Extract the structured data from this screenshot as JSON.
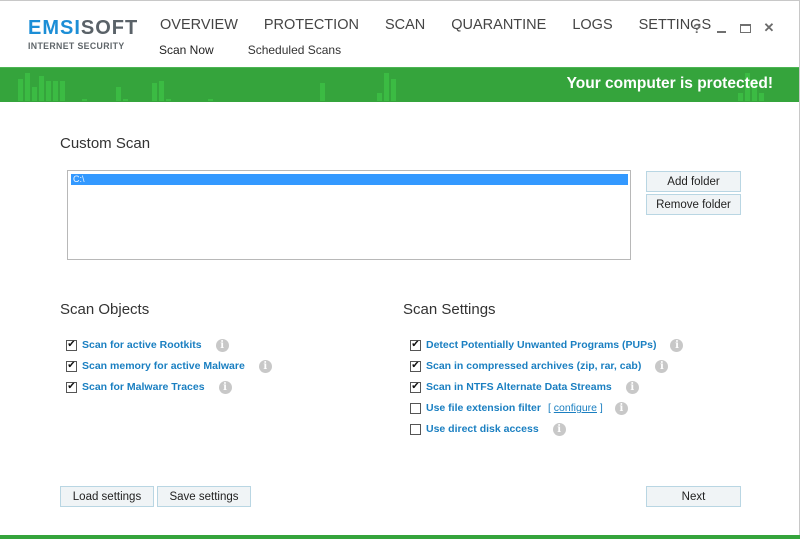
{
  "app": {
    "logo_main_blue": "EMSI",
    "logo_main_gray": "SOFT",
    "logo_sub": "INTERNET SECURITY"
  },
  "nav": {
    "items": [
      {
        "label": "OVERVIEW"
      },
      {
        "label": "PROTECTION"
      },
      {
        "label": "SCAN"
      },
      {
        "label": "QUARANTINE"
      },
      {
        "label": "LOGS"
      },
      {
        "label": "SETTINGS"
      }
    ],
    "active": "SCAN",
    "sub_items": [
      {
        "label": "Scan Now",
        "active": true
      },
      {
        "label": "Scheduled Scans",
        "active": false
      }
    ]
  },
  "window_controls": {
    "help_label": "?",
    "minimize": "minimize-icon",
    "maximize": "maximize-icon",
    "close": "close-icon",
    "close_label": "✕"
  },
  "banner": {
    "status_text": "Your computer is protected!",
    "color": "#35a43c",
    "bar_color": "#3bbb43"
  },
  "custom_scan": {
    "title": "Custom Scan",
    "folders": [
      "C:\\"
    ],
    "selected_index": 0,
    "add_folder_label": "Add folder",
    "remove_folder_label": "Remove folder"
  },
  "scan_objects": {
    "title": "Scan Objects",
    "options": [
      {
        "label": "Scan for active Rootkits",
        "checked": true
      },
      {
        "label": "Scan memory for active Malware",
        "checked": true
      },
      {
        "label": "Scan for Malware Traces",
        "checked": true
      }
    ]
  },
  "scan_settings": {
    "title": "Scan Settings",
    "options": [
      {
        "label": "Detect Potentially Unwanted Programs (PUPs)",
        "checked": true
      },
      {
        "label": "Scan in compressed archives (zip, rar, cab)",
        "checked": true
      },
      {
        "label": "Scan in NTFS Alternate Data Streams",
        "checked": true
      },
      {
        "label": "Use file extension filter",
        "checked": false
      },
      {
        "label": "Use direct disk access",
        "checked": false
      }
    ],
    "configure_open": "[",
    "configure_link": "configure",
    "configure_close": "]"
  },
  "footer": {
    "load_label": "Load settings",
    "save_label": "Save settings",
    "next_label": "Next"
  },
  "icons": {
    "info": "i",
    "checkmark": "✔"
  },
  "colors": {
    "accent_blue": "#1a7fc1",
    "selection_blue": "#3399ff",
    "status_green": "#35a43c"
  }
}
